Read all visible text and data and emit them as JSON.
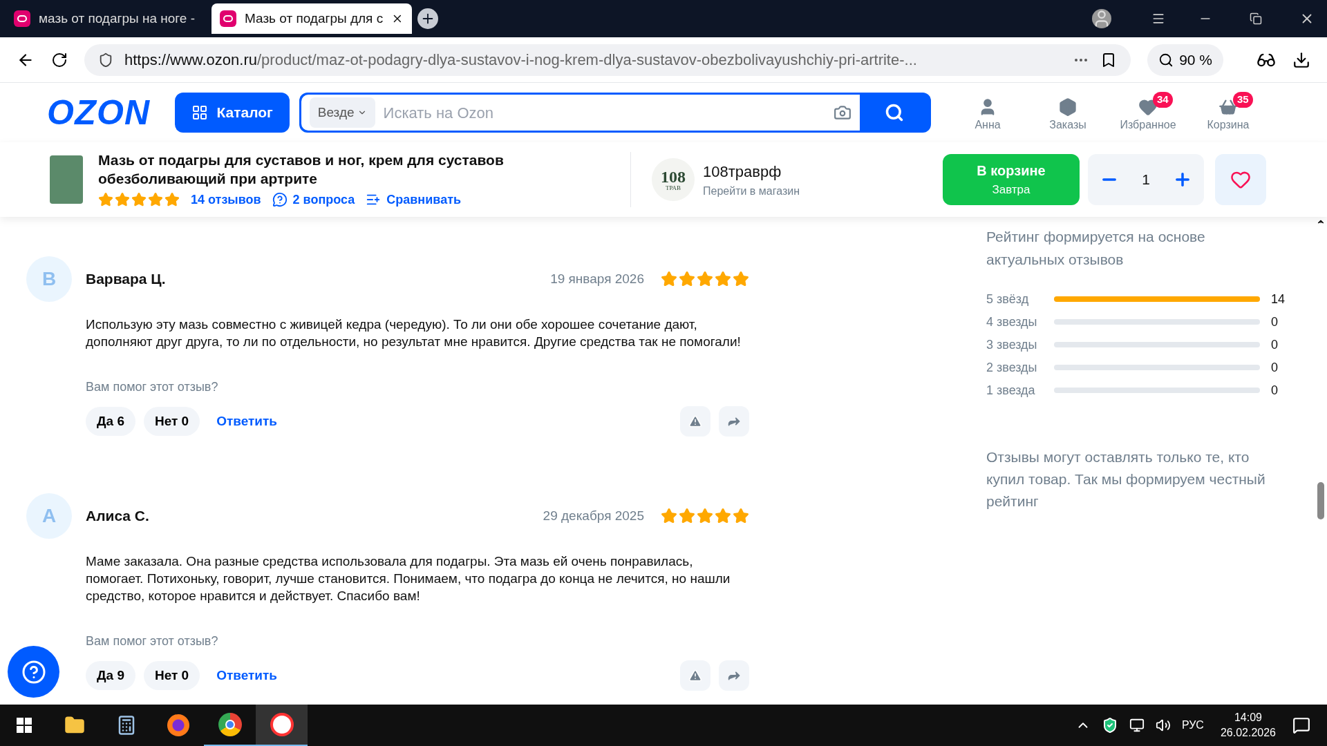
{
  "browser": {
    "tabs": [
      {
        "title": "мазь от подагры на ноге -",
        "selected": false
      },
      {
        "title": "Мазь от подагры для с",
        "selected": true
      }
    ],
    "url_domain": "https://www.ozon.ru",
    "url_path": "/product/maz-ot-podagry-dlya-sustavov-i-nog-krem-dlya-sustavov-obezbolivayushchiy-pri-artrite-...",
    "zoom": "90 %"
  },
  "header": {
    "logo": "OZON",
    "catalog": "Каталог",
    "scope": "Везде",
    "search_placeholder": "Искать на Ozon",
    "nav": [
      {
        "label": "Анна",
        "kind": "user"
      },
      {
        "label": "Заказы",
        "kind": "orders"
      },
      {
        "label": "Избранное",
        "kind": "favorites",
        "badge": "34"
      },
      {
        "label": "Корзина",
        "kind": "cart",
        "badge": "35"
      }
    ]
  },
  "product_bar": {
    "title": "Мазь от подагры для суставов и ног, крем для суставов обезболивающий при артрите",
    "stars": 5,
    "reviews": "14 отзывов",
    "questions": "2 вопроса",
    "compare": "Сравнивать",
    "shop_logo": "108",
    "shop_logo_sub": "ТРАВ",
    "shop": "108траврф",
    "shop_link": "Перейти в магазин",
    "cart_button": "В корзине",
    "cart_sub": "Завтра",
    "quantity": "1"
  },
  "reviews": [
    {
      "avatar": "В",
      "author": "Варвара Ц.",
      "date": "19 января 2026",
      "stars": 5,
      "text": "Использую эту мазь совместно с живицей кедра (чередую). То ли они обе хорошее сочетание дают, дополняют друг друга, то ли по отдельности, но результат мне нравится. Другие средства так не помогали!",
      "helpful": "Вам помог этот отзыв?",
      "yes": "Да 6",
      "no": "Нет 0",
      "reply": "Ответить"
    },
    {
      "avatar": "А",
      "author": "Алиса С.",
      "date": "29 декабря 2025",
      "stars": 5,
      "text": "Маме заказала. Она разные средства использовала для подагры. Эта мазь ей очень понравилась, помогает. Потихоньку, говорит, лучше становится. Понимаем, что подагра до конца не лечится, но нашли средство, которое нравится и действует. Спасибо вам!",
      "helpful": "Вам помог этот отзыв?",
      "yes": "Да 9",
      "no": "Нет 0",
      "reply": "Ответить"
    }
  ],
  "rating_panel": {
    "note": "Рейтинг формируется на основе актуальных отзывов",
    "rows": [
      {
        "label": "5 звёзд",
        "level": 1,
        "count": "14"
      },
      {
        "label": "4 звезды",
        "level": 0,
        "count": "0"
      },
      {
        "label": "3 звезды",
        "level": 0,
        "count": "0"
      },
      {
        "label": "2 звезды",
        "level": 0,
        "count": "0"
      },
      {
        "label": "1 звезда",
        "level": 0,
        "count": "0"
      }
    ],
    "footer": "Отзывы могут оставлять только те, кто купил товар. Так мы формируем честный рейтинг"
  },
  "taskbar": {
    "language": "РУС",
    "time": "14:09",
    "date": "26.02.2026"
  }
}
